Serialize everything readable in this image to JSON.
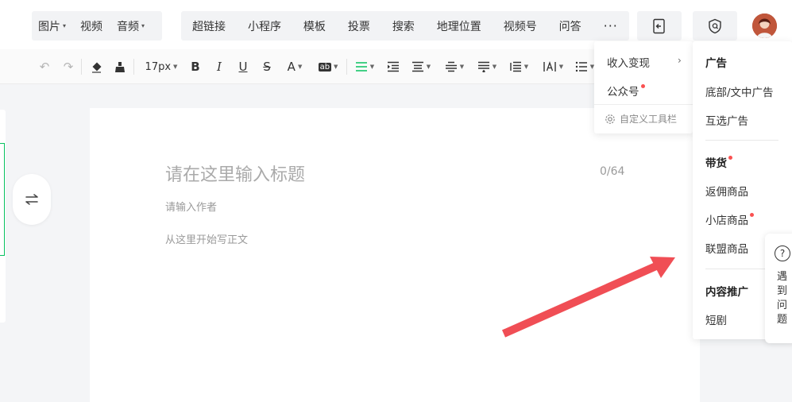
{
  "toolbar": {
    "media_group": [
      {
        "label": "图片",
        "caret": true
      },
      {
        "label": "视频",
        "caret": false
      },
      {
        "label": "音频",
        "caret": true
      }
    ],
    "insert_group": [
      "超链接",
      "小程序",
      "模板",
      "投票",
      "搜索",
      "地理位置",
      "视频号",
      "问答"
    ],
    "more_label": "···"
  },
  "format": {
    "font_size": "17px",
    "bold": "B",
    "italic": "I",
    "underline": "U",
    "strike": "S",
    "font_color": "A",
    "bg_color": "ab"
  },
  "editor": {
    "title_placeholder": "请在这里输入标题",
    "title_count": "0/64",
    "author_placeholder": "请输入作者",
    "body_placeholder": "从这里开始写正文"
  },
  "more_menu": {
    "monetize": "收入变现",
    "official_account": "公众号",
    "customize": "自定义工具栏"
  },
  "monetize_menu": {
    "ads_heading": "广告",
    "ads_items": [
      "底部/文中广告",
      "互选广告"
    ],
    "goods_heading": "带货",
    "goods_items": [
      "返佣商品",
      "小店商品",
      "联盟商品"
    ],
    "promo_heading": "内容推广",
    "promo_items": [
      "短剧"
    ]
  },
  "help": {
    "label": "遇到问题"
  },
  "colors": {
    "accent_green": "#07c160",
    "red_dot": "#fa5151",
    "arrow_red": "#f04e55"
  }
}
